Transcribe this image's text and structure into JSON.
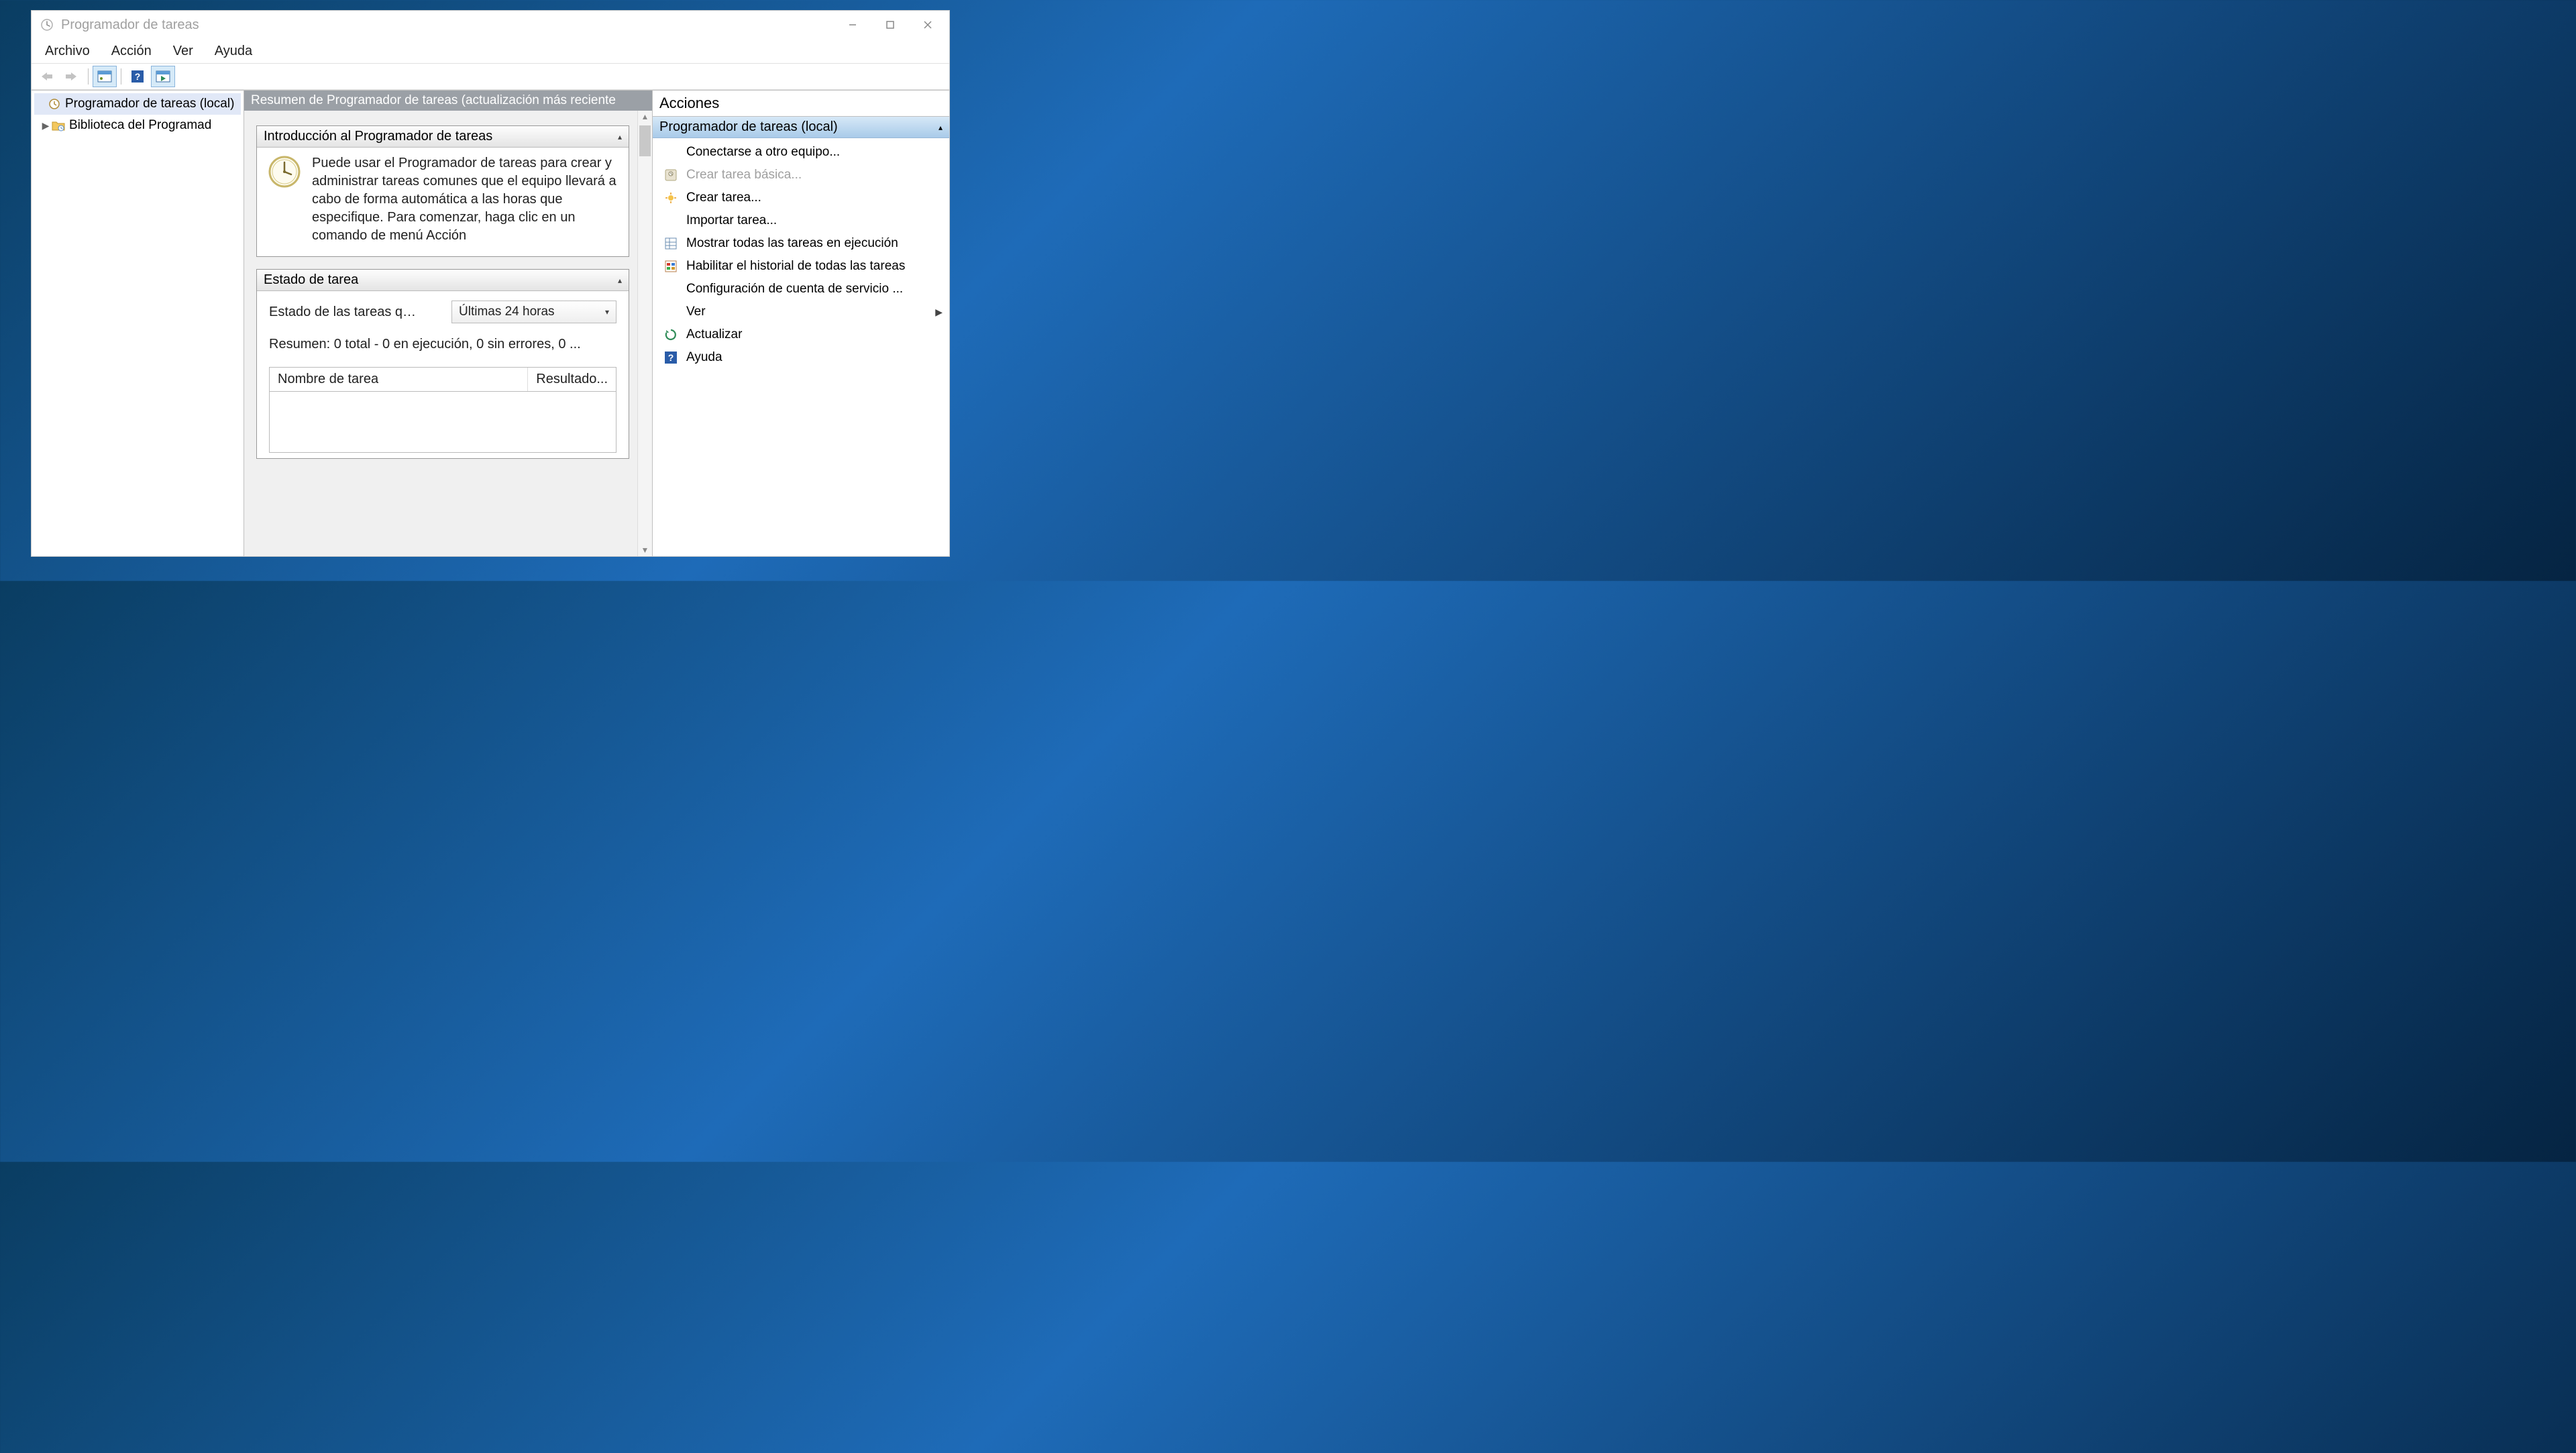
{
  "window": {
    "title": "Programador de tareas"
  },
  "menubar": [
    "Archivo",
    "Acción",
    "Ver",
    "Ayuda"
  ],
  "tree": {
    "root": "Programador de tareas (local)",
    "child": "Biblioteca del Programad"
  },
  "middle": {
    "header": "Resumen de Programador de tareas (actualización más reciente",
    "intro": {
      "title": "Introducción al Programador de tareas",
      "text": "Puede usar el Programador de tareas para crear y administrar tareas comunes que el equipo llevará a cabo de forma automática a las horas que especifique. Para comenzar, haga clic en un comando de menú Acción"
    },
    "status": {
      "title": "Estado de tarea",
      "label": "Estado de las tareas q…",
      "combo": "Últimas 24 horas",
      "summary": "Resumen: 0 total - 0 en ejecución, 0 sin errores, 0 ...",
      "cols": {
        "name": "Nombre de tarea",
        "result": "Resultado..."
      }
    }
  },
  "actions": {
    "title": "Acciones",
    "group": "Programador de tareas (local)",
    "items": [
      {
        "icon": "none",
        "label": "Conectarse a otro equipo...",
        "disabled": false,
        "sub": false
      },
      {
        "icon": "wizard",
        "label": "Crear tarea básica...",
        "disabled": true,
        "sub": false
      },
      {
        "icon": "spark",
        "label": "Crear tarea...",
        "disabled": false,
        "sub": false
      },
      {
        "icon": "none",
        "label": "Importar tarea...",
        "disabled": false,
        "sub": false
      },
      {
        "icon": "grid",
        "label": "Mostrar todas las tareas en ejecución",
        "disabled": false,
        "sub": false
      },
      {
        "icon": "history",
        "label": "Habilitar el historial de todas las tareas",
        "disabled": false,
        "sub": false
      },
      {
        "icon": "none",
        "label": "Configuración de cuenta de servicio ...",
        "disabled": false,
        "sub": false
      },
      {
        "icon": "none",
        "label": "Ver",
        "disabled": false,
        "sub": true
      },
      {
        "icon": "refresh",
        "label": "Actualizar",
        "disabled": false,
        "sub": false
      },
      {
        "icon": "help",
        "label": "Ayuda",
        "disabled": false,
        "sub": false
      }
    ]
  }
}
